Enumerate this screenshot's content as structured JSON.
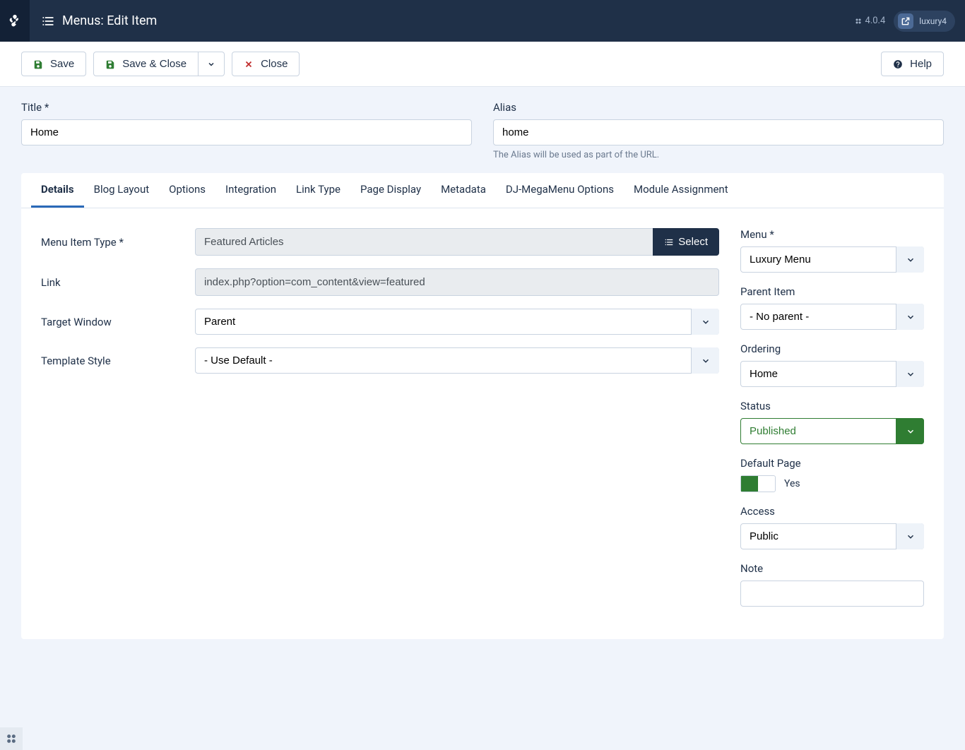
{
  "header": {
    "page_title": "Menus: Edit Item",
    "version": "4.0.4",
    "username": "luxury4"
  },
  "toolbar": {
    "save": "Save",
    "save_close": "Save & Close",
    "close": "Close",
    "help": "Help"
  },
  "form": {
    "title_label": "Title *",
    "title_value": "Home",
    "alias_label": "Alias",
    "alias_value": "home",
    "alias_help": "The Alias will be used as part of the URL."
  },
  "tabs": [
    "Details",
    "Blog Layout",
    "Options",
    "Integration",
    "Link Type",
    "Page Display",
    "Metadata",
    "DJ-MegaMenu Options",
    "Module Assignment"
  ],
  "details": {
    "menu_item_type_label": "Menu Item Type *",
    "menu_item_type_value": "Featured Articles",
    "select_btn": "Select",
    "link_label": "Link",
    "link_value": "index.php?option=com_content&view=featured",
    "target_window_label": "Target Window",
    "target_window_value": "Parent",
    "template_style_label": "Template Style",
    "template_style_value": "- Use Default -"
  },
  "sidebar": {
    "menu_label": "Menu *",
    "menu_value": "Luxury Menu",
    "parent_label": "Parent Item",
    "parent_value": "- No parent -",
    "ordering_label": "Ordering",
    "ordering_value": "Home",
    "status_label": "Status",
    "status_value": "Published",
    "default_page_label": "Default Page",
    "default_page_value": "Yes",
    "access_label": "Access",
    "access_value": "Public",
    "note_label": "Note"
  }
}
